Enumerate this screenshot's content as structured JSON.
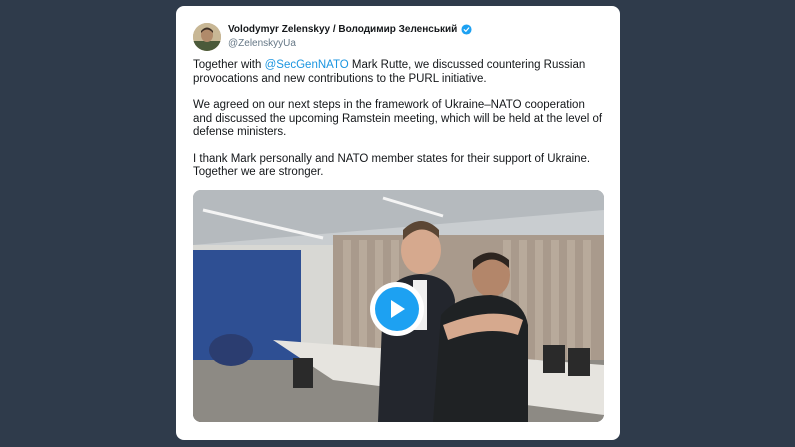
{
  "tweet": {
    "author_name": "Volodymyr Zelenskyy / Володимир Зеленський",
    "handle": "@ZelenskyyUa",
    "verified": true,
    "p1_before": "Together with ",
    "p1_mention": "@SecGenNATO",
    "p1_after": " Mark Rutte, we discussed countering Russian provocations and new contributions to the PURL initiative.",
    "p2": "We agreed on our next steps in the framework of Ukraine–NATO cooperation and discussed the upcoming Ramstein meeting, which will be held at the level of defense ministers.",
    "p3": "I thank Mark personally and NATO member states for their support of Ukraine. Together we are stronger."
  },
  "media": {
    "type": "video",
    "play_icon": "play-icon"
  },
  "colors": {
    "page_background": "#2f3b4b",
    "card_background": "#ffffff",
    "mention": "#1b95e0",
    "verified_badge": "#1da1f2",
    "play_button": "#1da1f2"
  }
}
